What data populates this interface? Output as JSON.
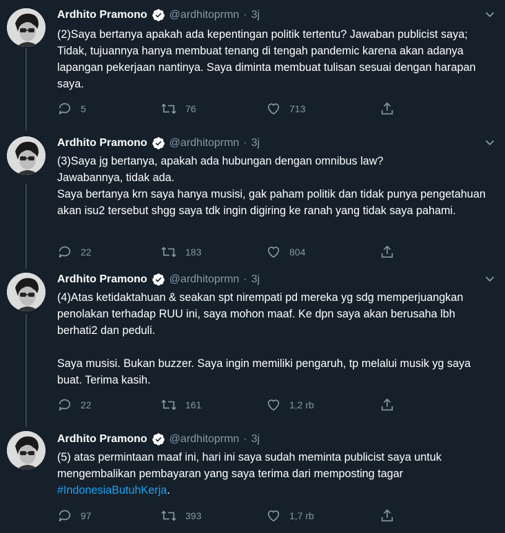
{
  "tweets": [
    {
      "name": "Ardhito Pramono",
      "handle": "@ardhitoprmn",
      "time": "3j",
      "text": "(2)Saya bertanya apakah ada kepentingan politik tertentu? Jawaban publicist saya; Tidak, tujuannya hanya membuat tenang di tengah pandemic karena akan adanya lapangan pekerjaan nantinya. Saya diminta membuat tulisan sesuai dengan harapan saya.",
      "replies": "5",
      "retweets": "76",
      "likes": "713"
    },
    {
      "name": "Ardhito Pramono",
      "handle": "@ardhitoprmn",
      "time": "3j",
      "text": "(3)Saya jg bertanya, apakah ada hubungan dengan omnibus law?\nJawabannya, tidak ada.\nSaya bertanya krn saya hanya musisi, gak paham politik dan tidak punya pengetahuan akan isu2 tersebut shgg saya tdk ingin digiring ke ranah yang tidak saya pahami.",
      "replies": "22",
      "retweets": "183",
      "likes": "804"
    },
    {
      "name": "Ardhito Pramono",
      "handle": "@ardhitoprmn",
      "time": "3j",
      "text": "(4)Atas ketidaktahuan & seakan spt nirempati pd mereka yg sdg memperjuangkan penolakan terhadap RUU ini, saya mohon maaf. Ke dpn saya akan berusaha lbh berhati2 dan peduli.\n\nSaya musisi. Bukan buzzer. Saya ingin memiliki pengaruh, tp melalui musik yg saya buat. Terima kasih.",
      "replies": "22",
      "retweets": "161",
      "likes": "1,2 rb"
    },
    {
      "name": "Ardhito Pramono",
      "handle": "@ardhitoprmn",
      "time": "3j",
      "text": "(5) atas permintaan maaf ini, hari ini saya sudah meminta publicist saya untuk mengembalikan pembayaran yang saya terima dari memposting tagar ",
      "hashtag": "#IndonesiaButuhKerja",
      "text_end": ".",
      "replies": "97",
      "retweets": "393",
      "likes": "1,7 rb"
    }
  ],
  "colors": {
    "background": "#15202b",
    "secondary": "#8899a6",
    "link": "#1da1f2",
    "thread": "#38444d"
  },
  "icons": [
    "verified-icon",
    "more-icon",
    "reply-icon",
    "retweet-icon",
    "like-icon",
    "share-icon"
  ]
}
